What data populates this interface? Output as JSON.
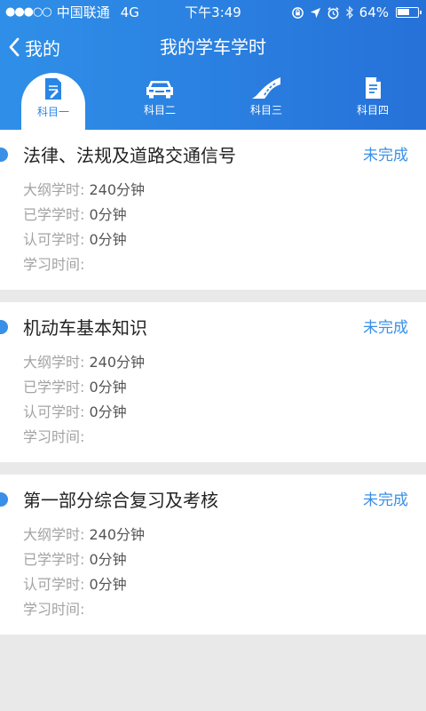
{
  "status_bar": {
    "signal": "●●●○○",
    "carrier": "中国联通",
    "network": "4G",
    "time": "下午3:49",
    "battery": "64%",
    "battery_level": 0.64
  },
  "nav": {
    "back_label": "我的",
    "title": "我的学车学时"
  },
  "tabs": [
    {
      "label": "科目一",
      "active": true
    },
    {
      "label": "科目二",
      "active": false
    },
    {
      "label": "科目三",
      "active": false
    },
    {
      "label": "科目四",
      "active": false
    }
  ],
  "field_labels": {
    "required": "大纲学时:",
    "studied": "已学学时:",
    "approved": "认可学时:",
    "study_time": "学习时间:"
  },
  "cards": [
    {
      "title": "法律、法规及道路交通信号",
      "status": "未完成",
      "required": "240分钟",
      "studied": "0分钟",
      "approved": "0分钟",
      "study_time": ""
    },
    {
      "title": "机动车基本知识",
      "status": "未完成",
      "required": "240分钟",
      "studied": "0分钟",
      "approved": "0分钟",
      "study_time": ""
    },
    {
      "title": "第一部分综合复习及考核",
      "status": "未完成",
      "required": "240分钟",
      "studied": "0分钟",
      "approved": "0分钟",
      "study_time": ""
    }
  ],
  "colors": {
    "header": "#2a7fe0",
    "accent": "#3a8fe6"
  },
  "icons": {
    "back": "chevron-left-icon",
    "tab1": "document-pen-icon",
    "tab2": "car-icon",
    "tab3": "road-icon",
    "tab4": "document-icon"
  }
}
